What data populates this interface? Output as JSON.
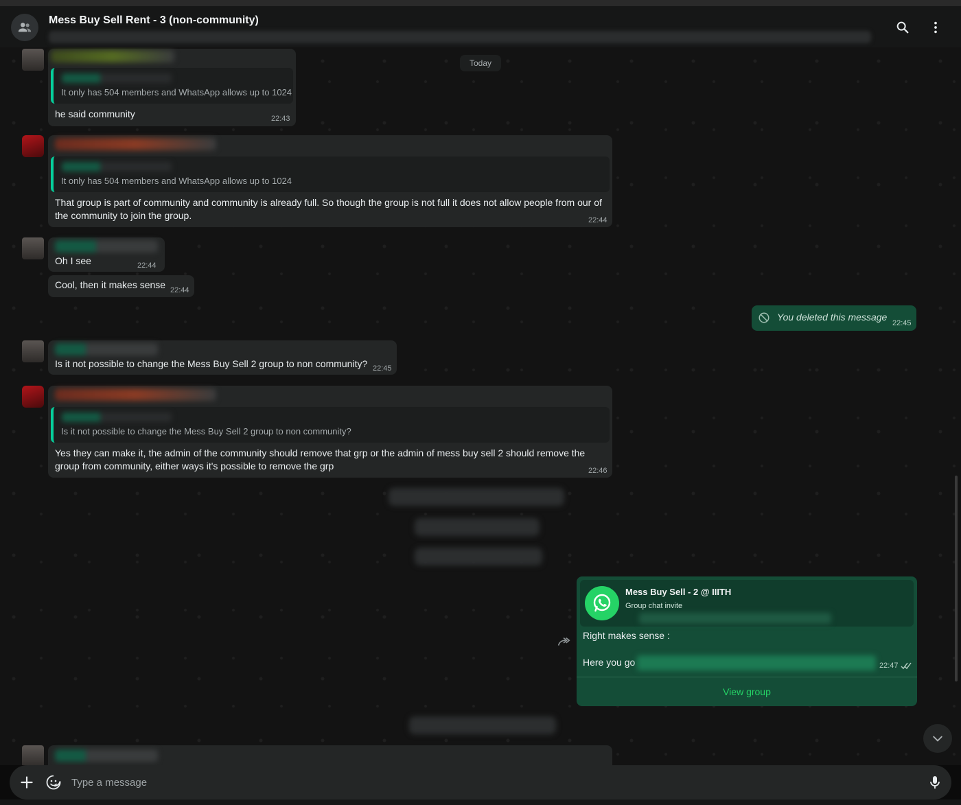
{
  "header": {
    "title": "Mess Buy Sell Rent - 3 (non-community)",
    "search_icon": "search-icon",
    "menu_icon": "more-vertical-icon"
  },
  "chat": {
    "day_label": "Today",
    "messages": [
      {
        "quote": "It only has 504 members and WhatsApp allows up to 1024",
        "text": "he said community",
        "time": "22:43"
      },
      {
        "quote": "It only has 504 members and WhatsApp allows up to 1024",
        "text": "That group is part of community and community is already full. So though the group is not full it does not allow people from our of the community to join the group.",
        "time": "22:44"
      },
      {
        "text": "Oh I see",
        "time": "22:44"
      },
      {
        "text": "Cool, then it makes sense",
        "time": "22:44"
      },
      {
        "text": "You deleted this message",
        "time": "22:45"
      },
      {
        "text": "Is it not possible to change the Mess Buy Sell 2 group to non community?",
        "time": "22:45"
      },
      {
        "quote": "Is it not possible to change the Mess Buy Sell 2 group to non community?",
        "text": "Yes they can make it, the admin of the community should remove that grp or the admin of mess buy sell 2 should remove the group from community, either ways it's possible to remove the grp",
        "time": "22:46"
      }
    ],
    "invite": {
      "group_name": "Mess Buy Sell - 2 @ IIITH",
      "subtitle": "Group chat invite",
      "line1": "Right makes sense :",
      "line2": "Here you go",
      "time": "22:47",
      "button": "View group",
      "status_icon": "double-check-icon"
    }
  },
  "composer": {
    "placeholder": "Type a message",
    "attach_icon": "plus-icon",
    "sticker_icon": "sticker-icon",
    "mic_icon": "mic-icon"
  },
  "colors": {
    "accent": "#25d366",
    "quote_bar": "#06cf9c",
    "incoming_bubble": "#242626",
    "outgoing_bubble": "#144d37",
    "background": "#131313"
  }
}
